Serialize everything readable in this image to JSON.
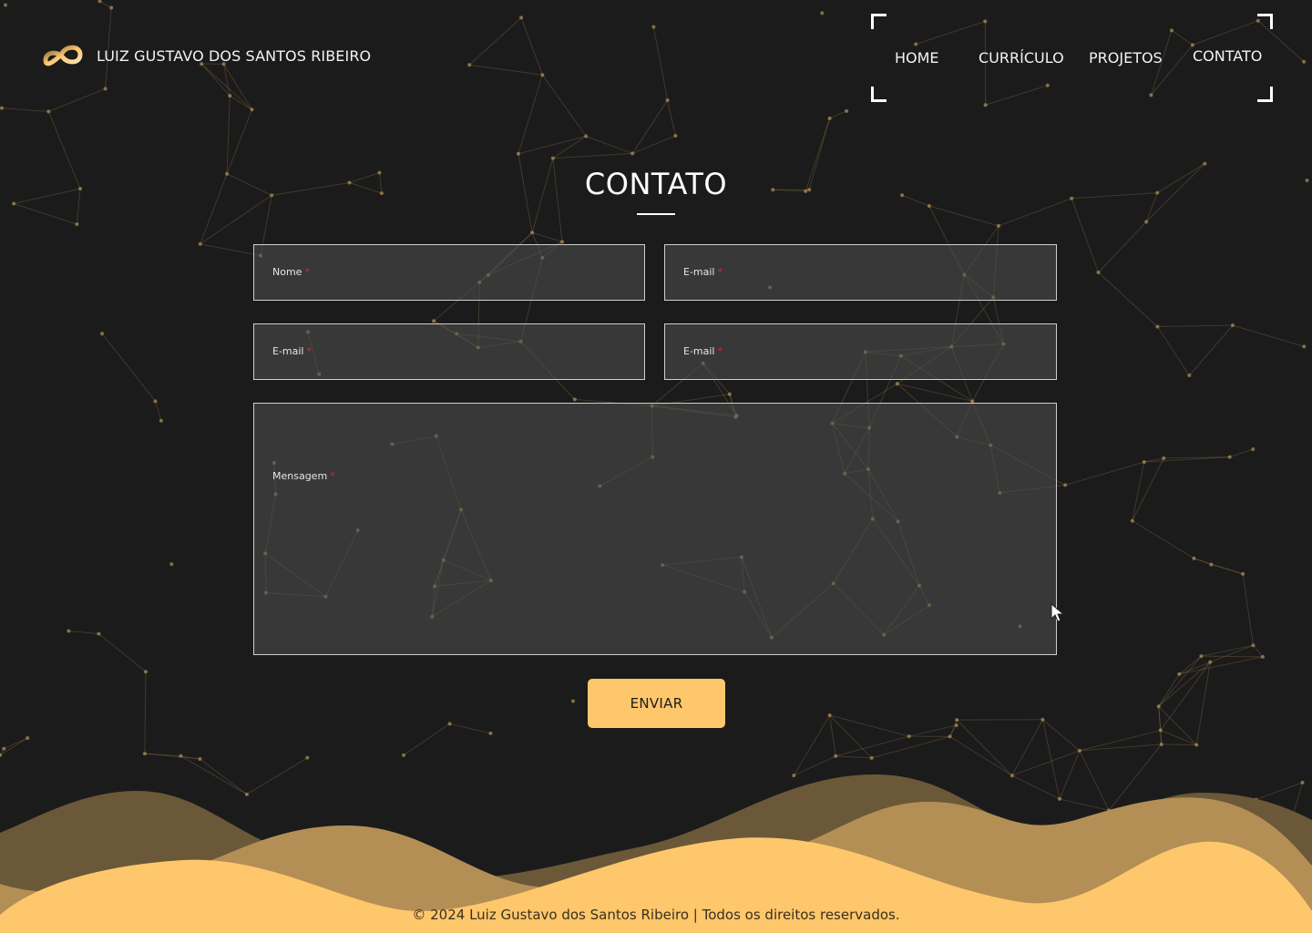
{
  "brand": {
    "name": "LUIZ GUSTAVO DOS SANTOS RIBEIRO",
    "logo_icon": "infinity-logo-icon"
  },
  "nav": {
    "items": [
      {
        "label": "HOME"
      },
      {
        "label": "CURRÍCULO"
      },
      {
        "label": "PROJETOS"
      },
      {
        "label": "CONTATO"
      }
    ],
    "active": "CONTATO"
  },
  "contact": {
    "title": "CONTATO",
    "fields": [
      {
        "label": "Nome",
        "required_mark": "*",
        "value": ""
      },
      {
        "label": "E-mail",
        "required_mark": "*",
        "value": ""
      },
      {
        "label": "E-mail",
        "required_mark": "*",
        "value": ""
      },
      {
        "label": "E-mail",
        "required_mark": "*",
        "value": ""
      }
    ],
    "message": {
      "label": "Mensagem",
      "required_mark": "*",
      "value": ""
    },
    "submit_label": "ENVIAR"
  },
  "footer": {
    "text": "© 2024 Luiz Gustavo dos Santos Ribeiro | Todos os direitos reservados."
  },
  "colors": {
    "background": "#1b1b1b",
    "accent": "#fec76c",
    "wave_dark": "#6b5838",
    "wave_mid": "#b38f55",
    "wave_light": "#fec76c",
    "required": "#d2272e"
  }
}
